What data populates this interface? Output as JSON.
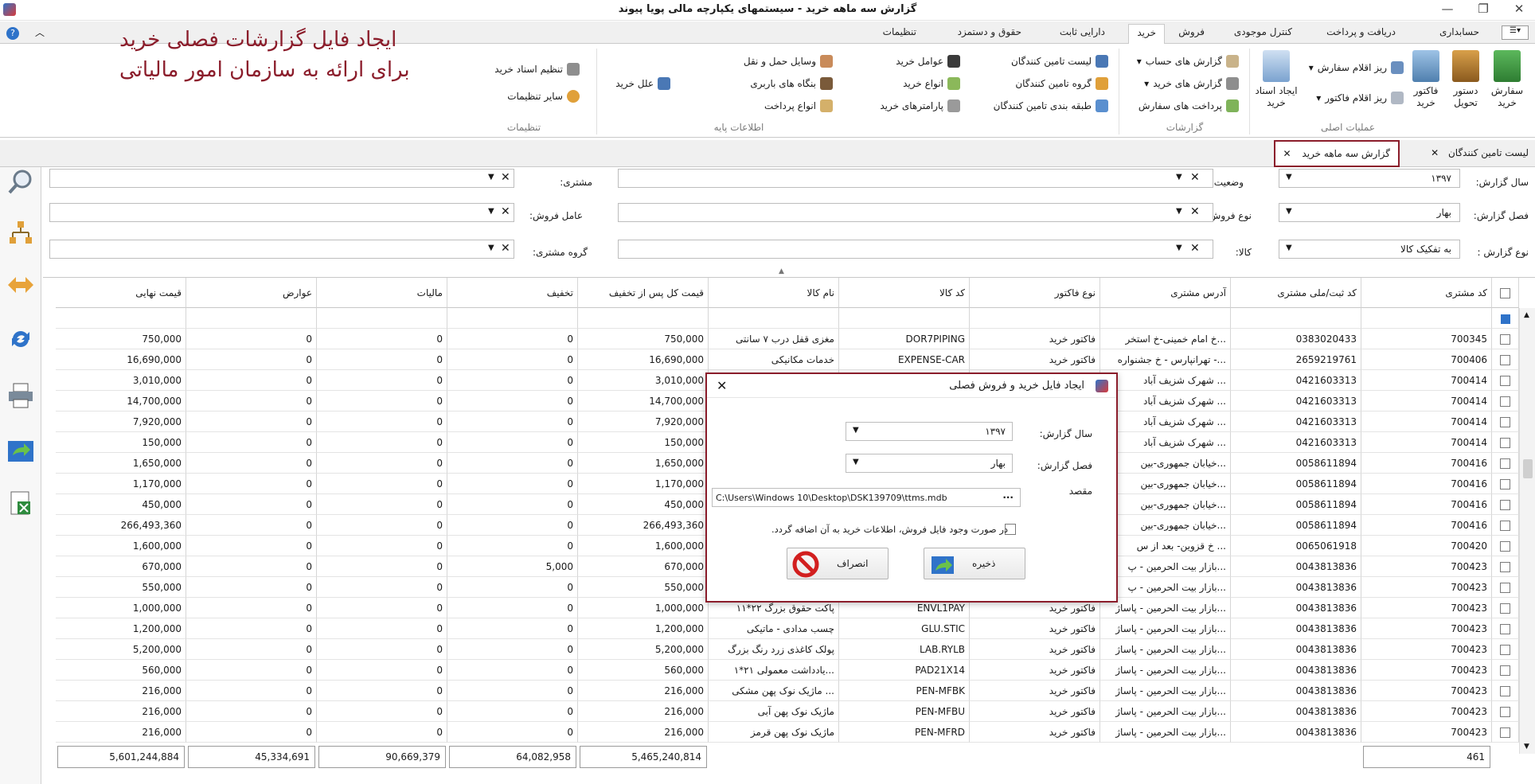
{
  "window": {
    "title": "گزارش سه ماهه خرید - سیستمهای یکپارچه مالی پویا پیوند"
  },
  "ribbon_tabs": [
    "حسابداری",
    "دریافت و پرداخت",
    "کنترل موجودی",
    "فروش",
    "خرید",
    "دارایی ثابت",
    "حقوق و دستمزد",
    "تنظیمات"
  ],
  "ribbon": {
    "main_ops": {
      "order_purchase": "سفارش خرید",
      "delivery": "دستور تحویل",
      "purchase_invoice": "فاکتور خرید",
      "order_items": "ریز اقلام سفارش",
      "invoice_items": "ریز اقلام فاکتور",
      "create_docs": "ایجاد اسناد خرید",
      "label": "عملیات اصلی"
    },
    "reports": {
      "account_reports": "گزارش های حساب",
      "purchase_reports": "گزارش های خرید",
      "order_payments": "پرداخت های سفارش",
      "label": "گزارشات"
    },
    "base_info": {
      "supplier_list": "لیست تامین کنندگان",
      "supplier_group": "گروه تامین کنندگان",
      "supplier_class": "طبقه بندی تامین کنندگان",
      "buyer_agents": "عوامل خرید",
      "purchase_types": "انواع خرید",
      "purchase_params": "پارامترهای خرید",
      "transport": "وسایل حمل و نقل",
      "freight": "بنگاه های باربری",
      "payment_types": "انواع پرداخت",
      "purchase_reasons": "علل خرید",
      "label": "اطلاعات پایه"
    },
    "settings": {
      "doc_setup": "تنظیم اسناد خرید",
      "other_settings": "سایر تنظیمات",
      "label": "تنظیمات"
    }
  },
  "annotation": {
    "line1": "ایجاد فایل گزارشات فصلی خرید",
    "line2": "برای ارائه به سازمان امور مالیاتی"
  },
  "doc_tabs": {
    "active": "گزارش سه ماهه خرید",
    "other": "لیست تامین کنندگان"
  },
  "filters": {
    "year_label": "سال گزارش:",
    "year_value": "۱۳۹۷",
    "season_label": "فصل گزارش:",
    "season_value": "بهار",
    "type_label": "نوع گزارش :",
    "type_value": "به تفکیک کالا",
    "status_label": "وضعیت:",
    "sale_type_label": "نوع فروش:",
    "goods_label": "کالا:",
    "customer_label": "مشتری:",
    "sales_agent_label": "عامل فروش:",
    "customer_group_label": "گروه مشتری:"
  },
  "grid": {
    "columns": [
      "کد مشتری",
      "کد ثبت/ملی مشتری",
      "آدرس مشتری",
      "نوع فاکتور",
      "کد کالا",
      "نام کالا",
      "قیمت کل پس از تخفیف",
      "تخفیف",
      "مالیات",
      "عوارض",
      "قیمت نهایی"
    ],
    "rows": [
      [
        "700345",
        "0383020433",
        "...خ امام خمینی-خ استخر",
        "فاکتور خرید",
        "DOR7PIPING",
        "مغزی قفل درب ۷ سانتی",
        "750,000",
        "0",
        "0",
        "0",
        "750,000"
      ],
      [
        "700406",
        "2659219761",
        "...- تهرانپارس - خ جشنواره",
        "فاکتور خرید",
        "EXPENSE-CAR",
        "خدمات مکانیکی",
        "16,690,000",
        "0",
        "0",
        "0",
        "16,690,000"
      ],
      [
        "700414",
        "0421603313",
        "... شهرک شزیف آباد",
        "",
        "",
        "",
        "3,010,000",
        "0",
        "0",
        "0",
        "3,010,000"
      ],
      [
        "700414",
        "0421603313",
        "... شهرک شزیف آباد",
        "",
        "",
        "",
        "14,700,000",
        "0",
        "0",
        "0",
        "14,700,000"
      ],
      [
        "700414",
        "0421603313",
        "... شهرک شزیف آباد",
        "",
        "",
        "",
        "7,920,000",
        "0",
        "0",
        "0",
        "7,920,000"
      ],
      [
        "700414",
        "0421603313",
        "... شهرک شزیف آباد",
        "",
        "",
        "",
        "150,000",
        "0",
        "0",
        "0",
        "150,000"
      ],
      [
        "700416",
        "0058611894",
        "...خیابان جمهوری-بین",
        "",
        "",
        "",
        "1,650,000",
        "0",
        "0",
        "0",
        "1,650,000"
      ],
      [
        "700416",
        "0058611894",
        "...خیابان جمهوری-بین",
        "",
        "",
        "",
        "1,170,000",
        "0",
        "0",
        "0",
        "1,170,000"
      ],
      [
        "700416",
        "0058611894",
        "...خیابان جمهوری-بین",
        "",
        "",
        "",
        "450,000",
        "0",
        "0",
        "0",
        "450,000"
      ],
      [
        "700416",
        "0058611894",
        "...خیابان جمهوری-بین",
        "",
        "",
        "",
        "266,493,360",
        "0",
        "0",
        "0",
        "266,493,360"
      ],
      [
        "700420",
        "0065061918",
        "... خ قزوین- بعد از س",
        "",
        "",
        "",
        "1,600,000",
        "0",
        "0",
        "0",
        "1,600,000"
      ],
      [
        "700423",
        "0043813836",
        "...بازار بیت الحرمین - پ",
        "",
        "",
        "",
        "670,000",
        "5,000",
        "0",
        "0",
        "670,000"
      ],
      [
        "700423",
        "0043813836",
        "...بازار بیت الحرمین - پ",
        "",
        "",
        "",
        "550,000",
        "0",
        "0",
        "0",
        "550,000"
      ],
      [
        "700423",
        "0043813836",
        "...بازار بیت الحرمین - پاساژ",
        "فاکتور خرید",
        "ENVL1PAY",
        "پاکت حقوق بزرگ ۲۲*۱۱",
        "1,000,000",
        "0",
        "0",
        "0",
        "1,000,000"
      ],
      [
        "700423",
        "0043813836",
        "...بازار بیت الحرمین - پاساژ",
        "فاکتور خرید",
        "GLU.STIC",
        "چسب مدادی - ماتیکی",
        "1,200,000",
        "0",
        "0",
        "0",
        "1,200,000"
      ],
      [
        "700423",
        "0043813836",
        "...بازار بیت الحرمین - پاساژ",
        "فاکتور خرید",
        "LAB.RYLB",
        "پولک کاغذی زرد رنگ بزرگ",
        "5,200,000",
        "0",
        "0",
        "0",
        "5,200,000"
      ],
      [
        "700423",
        "0043813836",
        "...بازار بیت الحرمین - پاساژ",
        "فاکتور خرید",
        "PAD21X14",
        "...یادداشت معمولی ۲۱*۱",
        "560,000",
        "0",
        "0",
        "0",
        "560,000"
      ],
      [
        "700423",
        "0043813836",
        "...بازار بیت الحرمین - پاساژ",
        "فاکتور خرید",
        "PEN-MFBK",
        "... ماژیک نوک پهن مشکی",
        "216,000",
        "0",
        "0",
        "0",
        "216,000"
      ],
      [
        "700423",
        "0043813836",
        "...بازار بیت الحرمین - پاساژ",
        "فاکتور خرید",
        "PEN-MFBU",
        "ماژیک نوک پهن آبی",
        "216,000",
        "0",
        "0",
        "0",
        "216,000"
      ],
      [
        "700423",
        "0043813836",
        "...بازار بیت الحرمین - پاساژ",
        "فاکتور خرید",
        "PEN-MFRD",
        "ماژیک نوک پهن قرمز",
        "216,000",
        "0",
        "0",
        "0",
        "216,000"
      ]
    ],
    "footer": {
      "count": "461",
      "total_after_discount": "5,465,240,814",
      "discount": "64,082,958",
      "tax": "90,669,379",
      "duties": "45,334,691",
      "final": "5,601,244,884"
    }
  },
  "dialog": {
    "title": "ایجاد فایل خرید و فروش فصلی",
    "year_label": "سال گزارش:",
    "year_value": "۱۳۹۷",
    "season_label": "فصل گزارش:",
    "season_value": "بهار",
    "dest_label": "مقصد",
    "dest_value": "C:\\Users\\Windows 10\\Desktop\\DSK139709\\ttms.mdb",
    "browse": "...",
    "append_label": "در صورت وجود فایل فروش، اطلاعات خرید به آن اضافه گردد.",
    "save": "ذخیره",
    "cancel": "انصراف"
  },
  "colors": {
    "accent": "#8b1d2b",
    "ribbon_bg": "#ffffff",
    "tab_bg": "#f0f0f0"
  }
}
